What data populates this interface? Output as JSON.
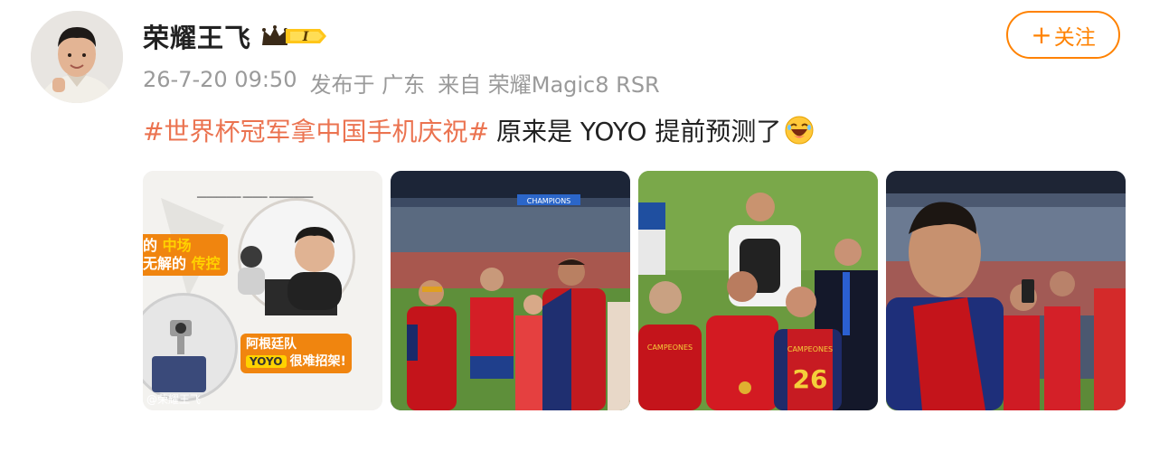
{
  "post": {
    "author": "荣耀王飞",
    "vip_badge": "I",
    "meta": {
      "time": "26-7-20 09:50",
      "location": "发布于 广东",
      "source": "来自 荣耀Magic8 RSR"
    },
    "follow_label": "关注",
    "hashtag": "#世界杯冠军拿中国手机庆祝#",
    "text": "原来是 YOYO 提前预测了",
    "images": [
      {
        "callout_1_a": "的",
        "callout_1_b": "中场",
        "callout_1_c": "无解的",
        "callout_1_d": "传控",
        "callout_2_a": "阿根廷队",
        "callout_2_yoyo": "YOYO",
        "callout_2_b": "很难招架!",
        "watermark": "@荣耀王飞"
      },
      {
        "banner": "CHAMPIONS"
      },
      {
        "jersey_a": "CAMPEONES",
        "jersey_b": "CAMPEONES",
        "number": "26"
      },
      {}
    ]
  },
  "colors": {
    "accent": "#ff8200",
    "hashtag": "#eb7350",
    "meta": "#9a9a9a"
  },
  "icons": [
    "vip-crown-icon",
    "plus-icon",
    "laughing-emoji-icon"
  ]
}
